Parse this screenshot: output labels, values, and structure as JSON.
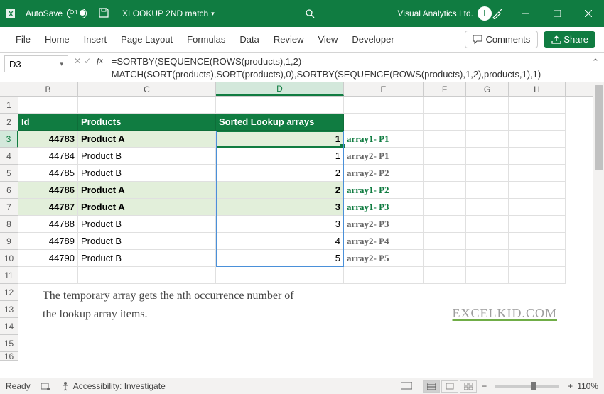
{
  "titlebar": {
    "autosave_label": "AutoSave",
    "toggle_label": "Off",
    "filename": "XLOOKUP 2ND match",
    "company": "Visual Analytics Ltd.",
    "avatar_letter": "i"
  },
  "ribbon": {
    "tabs": [
      "File",
      "Home",
      "Insert",
      "Page Layout",
      "Formulas",
      "Data",
      "Review",
      "View",
      "Developer"
    ],
    "comments": "Comments",
    "share": "Share"
  },
  "namebox": "D3",
  "formula": "=SORTBY(SEQUENCE(ROWS(products),1,2)-MATCH(SORT(products),SORT(products),0),SORTBY(SEQUENCE(ROWS(products),1,2),products,1),1)",
  "columns": [
    "B",
    "C",
    "D",
    "E",
    "F",
    "G",
    "H"
  ],
  "headers": {
    "id": "Id",
    "products": "Products",
    "sorted": "Sorted Lookup arrays"
  },
  "rows": [
    {
      "n": 3,
      "id": "44783",
      "prod": "Product A",
      "val": "1",
      "ann": "array1- P1",
      "hl": true,
      "green": true
    },
    {
      "n": 4,
      "id": "44784",
      "prod": "Product B",
      "val": "1",
      "ann": "array2- P1",
      "hl": false,
      "green": false
    },
    {
      "n": 5,
      "id": "44785",
      "prod": "Product B",
      "val": "2",
      "ann": "array2- P2",
      "hl": false,
      "green": false
    },
    {
      "n": 6,
      "id": "44786",
      "prod": "Product A",
      "val": "2",
      "ann": "array1- P2",
      "hl": true,
      "green": true
    },
    {
      "n": 7,
      "id": "44787",
      "prod": "Product A",
      "val": "3",
      "ann": "array1- P3",
      "hl": true,
      "green": true
    },
    {
      "n": 8,
      "id": "44788",
      "prod": "Product B",
      "val": "3",
      "ann": "array2- P3",
      "hl": false,
      "green": false
    },
    {
      "n": 9,
      "id": "44789",
      "prod": "Product B",
      "val": "4",
      "ann": "array2- P4",
      "hl": false,
      "green": false
    },
    {
      "n": 10,
      "id": "44790",
      "prod": "Product B",
      "val": "5",
      "ann": "array2- P5",
      "hl": false,
      "green": false
    }
  ],
  "note": "The temporary array gets the nth occurrence number of the lookup array items.",
  "watermark": "EXCELKID.COM",
  "statusbar": {
    "ready": "Ready",
    "accessibility": "Accessibility: Investigate",
    "zoom": "110%"
  }
}
